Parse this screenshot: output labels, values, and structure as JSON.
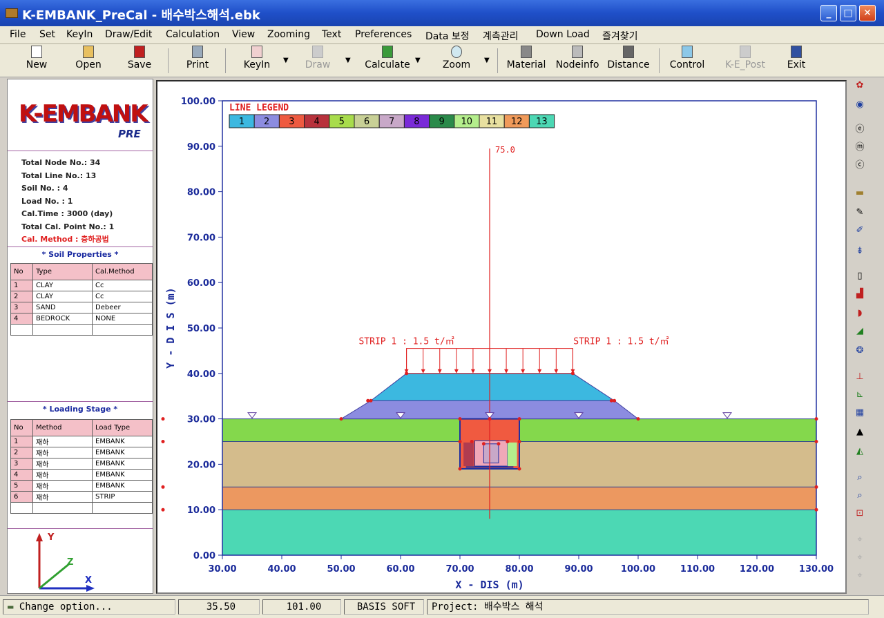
{
  "window": {
    "title": "K-EMBANK_PreCal - 배수박스해석.ebk",
    "min": "_",
    "max": "□",
    "close": "✕"
  },
  "menu": [
    "File",
    "Set",
    "KeyIn",
    "Draw/Edit",
    "Calculation",
    "View",
    "Zooming",
    "Text",
    "Preferences",
    "Data 보정",
    "계측관리",
    "Down Load",
    "즐겨찾기"
  ],
  "toolbar": {
    "new": "New",
    "open": "Open",
    "save": "Save",
    "print": "Print",
    "keyin": "KeyIn",
    "draw": "Draw",
    "calculate": "Calculate",
    "zoom": "Zoom",
    "material": "Material",
    "nodeinfo": "Nodeinfo",
    "distance": "Distance",
    "control": "Control",
    "kepost": "K-E_Post",
    "exit": "Exit"
  },
  "logo": {
    "main": "K-EMBANK",
    "sub": "PRE"
  },
  "stats": {
    "nodes": "Total Node No.: 34",
    "lines": "Total Line No.: 13",
    "soil": "Soil No. : 4",
    "load": "Load No. : 1",
    "caltime": "Cal.Time : 3000 (day)",
    "calpoint": "Total Cal. Point No.: 1",
    "calmethod": "Cal. Method : 층하공법"
  },
  "soil_properties": {
    "title": "* Soil Properties *",
    "headers": [
      "No",
      "Type",
      "Cal.Method"
    ],
    "rows": [
      [
        "1",
        "CLAY",
        "Cc"
      ],
      [
        "2",
        "CLAY",
        "Cc"
      ],
      [
        "3",
        "SAND",
        "Debeer"
      ],
      [
        "4",
        "BEDROCK",
        "NONE"
      ]
    ]
  },
  "loading_stage": {
    "title": "* Loading Stage *",
    "headers": [
      "No",
      "Method",
      "Load Type"
    ],
    "rows": [
      [
        "1",
        "재하",
        "EMBANK"
      ],
      [
        "2",
        "재하",
        "EMBANK"
      ],
      [
        "3",
        "재하",
        "EMBANK"
      ],
      [
        "4",
        "재하",
        "EMBANK"
      ],
      [
        "5",
        "재하",
        "EMBANK"
      ],
      [
        "6",
        "재하",
        "STRIP"
      ]
    ]
  },
  "axis_gizmo": {
    "y": "Y",
    "z": "Z",
    "x": "X"
  },
  "plot": {
    "legend_title": "LINE LEGEND",
    "legend": [
      {
        "n": "1",
        "c": "#3cb8e0"
      },
      {
        "n": "2",
        "c": "#8c8ce0"
      },
      {
        "n": "3",
        "c": "#ee5a40"
      },
      {
        "n": "4",
        "c": "#b8323c"
      },
      {
        "n": "5",
        "c": "#a8dc4c"
      },
      {
        "n": "6",
        "c": "#c8d096"
      },
      {
        "n": "7",
        "c": "#c8a8c8"
      },
      {
        "n": "8",
        "c": "#7a2ad8"
      },
      {
        "n": "9",
        "c": "#2a8a4a"
      },
      {
        "n": "10",
        "c": "#b4ee8c"
      },
      {
        "n": "11",
        "c": "#e8e0a0"
      },
      {
        "n": "12",
        "c": "#f09a5a"
      },
      {
        "n": "13",
        "c": "#4cd8b4"
      }
    ],
    "xlabel": "X - DIS (m)",
    "ylabel": "Y - D I S (m)",
    "xticks": [
      "30.00",
      "40.00",
      "50.00",
      "60.00",
      "70.00",
      "80.00",
      "90.00",
      "100.00",
      "110.00",
      "120.00",
      "130.00"
    ],
    "yticks": [
      "0.00",
      "10.00",
      "20.00",
      "30.00",
      "40.00",
      "50.00",
      "60.00",
      "70.00",
      "80.00",
      "90.00",
      "100.00"
    ],
    "xlim": [
      30,
      130
    ],
    "ylim": [
      0,
      100
    ],
    "centerline_label": "75.0",
    "strip_label_left": "STRIP 1 : 1.5 t/㎡",
    "strip_label_right": "STRIP 1 : 1.5 t/㎡",
    "colors": {
      "layer1": "#84d84c",
      "layer2": "#d4bc8c",
      "layer3": "#ec9860",
      "layer4": "#4cd8b4",
      "embank_upper": "#3cb8e0",
      "embank_lower": "#8c8ce0",
      "box_top": "#f05a40",
      "box_fill": "#f0a8b8",
      "accent_red": "#e02020",
      "axis_blue": "#1a2a9a"
    }
  },
  "status": {
    "message": "Change option...",
    "x": "35.50",
    "y": "101.00",
    "company": "BASIS SOFT",
    "project": "Project:  배수박스 해석"
  }
}
